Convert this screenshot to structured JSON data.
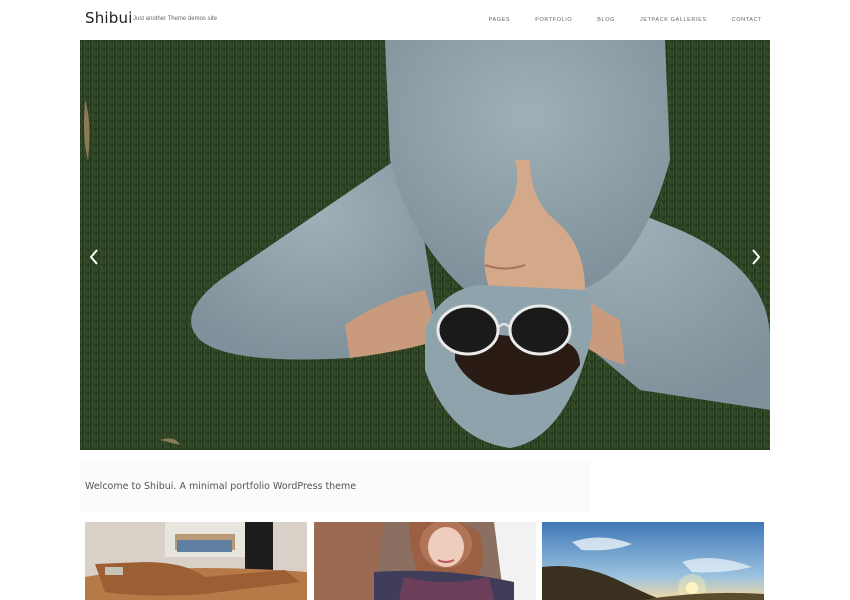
{
  "site": {
    "title": "Shibui",
    "tagline": "Just another Theme demos site"
  },
  "nav": {
    "items": [
      "PAGES",
      "PORTFOLIO",
      "BLOG",
      "JETPACK GALLERIES",
      "CONTACT"
    ]
  },
  "slider": {
    "image": "person-lying-on-grass-with-sunglasses",
    "prev_icon": "chevron-left-icon",
    "next_icon": "chevron-right-icon"
  },
  "intro": {
    "text": "Welcome to Shibui. A minimal portfolio WordPress theme"
  },
  "portfolio": {
    "thumbnails": [
      {
        "image": "leather-bag-on-desk"
      },
      {
        "image": "woman-with-scarf"
      },
      {
        "image": "sunset-over-hills"
      }
    ]
  },
  "colors": {
    "background": "#ffffff",
    "text": "#555555",
    "nav_text": "#666666"
  }
}
